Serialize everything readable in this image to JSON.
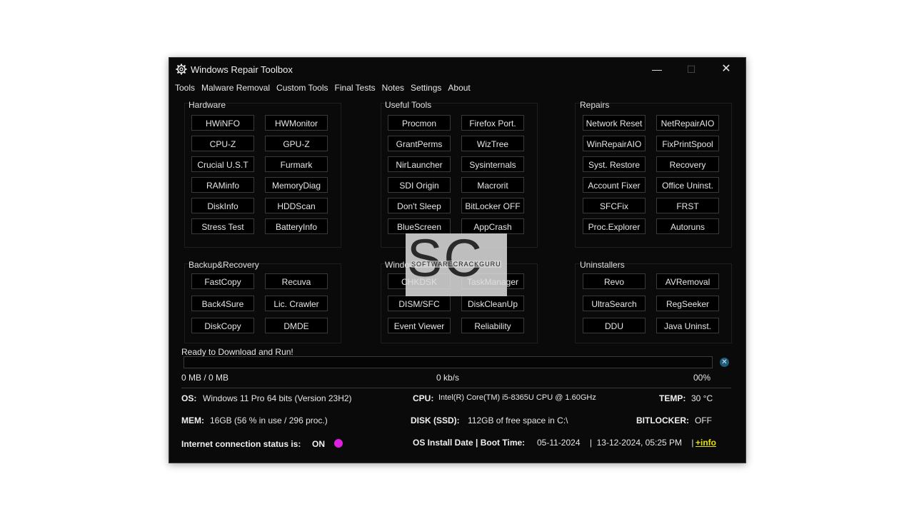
{
  "window": {
    "title": "Windows Repair Toolbox",
    "controls": {
      "minimize": "—",
      "maximize": "☐",
      "close": "✕"
    }
  },
  "menu": [
    "Tools",
    "Malware Removal",
    "Custom Tools",
    "Final Tests",
    "Notes",
    "Settings",
    "About"
  ],
  "groups": {
    "hardware": {
      "label": "Hardware",
      "buttons": [
        "HWiNFO",
        "HWMonitor",
        "CPU-Z",
        "GPU-Z",
        "Crucial U.S.T",
        "Furmark",
        "RAMinfo",
        "MemoryDiag",
        "DiskInfo",
        "HDDScan",
        "Stress Test",
        "BatteryInfo"
      ]
    },
    "useful": {
      "label": "Useful Tools",
      "buttons": [
        "Procmon",
        "Firefox Port.",
        "GrantPerms",
        "WizTree",
        "NirLauncher",
        "Sysinternals",
        "SDI Origin",
        "Macrorit",
        "Don't Sleep",
        "BitLocker OFF",
        "BlueScreen",
        "AppCrash"
      ]
    },
    "repairs": {
      "label": "Repairs",
      "buttons": [
        "Network Reset",
        "NetRepairAIO",
        "WinRepairAIO",
        "FixPrintSpool",
        "Syst. Restore",
        "Recovery",
        "Account Fixer",
        "Office Uninst.",
        "SFCFix",
        "FRST",
        "Proc.Explorer",
        "Autoruns"
      ]
    },
    "backup": {
      "label": "Backup&Recovery",
      "buttons": [
        "FastCopy",
        "Recuva",
        "Back4Sure",
        "Lic. Crawler",
        "DiskCopy",
        "DMDE"
      ]
    },
    "windows": {
      "label": "Windows",
      "buttons": [
        "CHKDSK",
        "TaskManager",
        "DISM/SFC",
        "DiskCleanUp",
        "Event Viewer",
        "Reliability"
      ]
    },
    "uninstallers": {
      "label": "Uninstallers",
      "buttons": [
        "Revo",
        "AVRemoval",
        "UltraSearch",
        "RegSeeker",
        "DDU",
        "Java Uninst."
      ]
    }
  },
  "status": {
    "message": "Ready to Download and Run!",
    "size": "0 MB / 0 MB",
    "speed": "0 kb/s",
    "percent": "00%",
    "progress_fraction": 0
  },
  "system": {
    "os_label": "OS:",
    "os_value": "Windows 11 Pro 64 bits (Version 23H2)",
    "cpu_label": "CPU:",
    "cpu_value": "Intel(R) Core(TM) i5-8365U CPU @ 1.60GHz",
    "temp_label": "TEMP:",
    "temp_value": "30 °C",
    "mem_label": "MEM:",
    "mem_value": "16GB  (56 % in use / 296 proc.)",
    "disk_label": "DISK (SSD):",
    "disk_value": "112GB of free space in C:\\",
    "bitlocker_label": "BITLOCKER:",
    "bitlocker_value": "OFF",
    "internet_label": "Internet connection status is:",
    "internet_value": "ON",
    "install_label": "OS Install Date | Boot Time:",
    "install_value": "05-11-2024    |  13-12-2024, 05:25 PM    |",
    "more_link": "+info"
  },
  "colors": {
    "online": "#e020e0",
    "link": "#e7e000"
  },
  "watermark": {
    "big": "SC",
    "small": "SOFTWARECRACKGURU"
  }
}
